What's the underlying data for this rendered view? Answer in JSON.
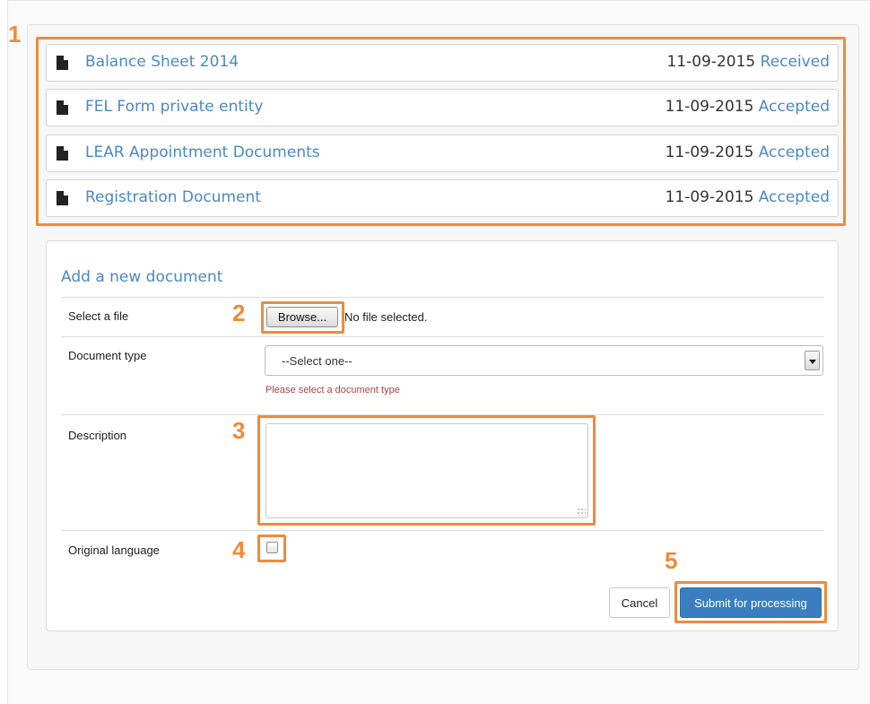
{
  "documents": [
    {
      "title": "Balance Sheet 2014",
      "date": "11-09-2015",
      "status": "Received",
      "icon": "file-icon"
    },
    {
      "title": "FEL Form private entity",
      "date": "11-09-2015",
      "status": "Accepted",
      "icon": "file-icon"
    },
    {
      "title": "LEAR Appointment Documents",
      "date": "11-09-2015",
      "status": "Accepted",
      "icon": "file-icon"
    },
    {
      "title": "Registration Document",
      "date": "11-09-2015",
      "status": "Accepted",
      "icon": "file-icon"
    }
  ],
  "form": {
    "title": "Add a new document",
    "select_file_label": "Select a file",
    "browse_label": "Browse...",
    "file_status": "No file selected.",
    "document_type_label": "Document type",
    "document_type_value": "--Select one--",
    "document_type_error": "Please select a document type",
    "description_label": "Description",
    "description_value": "",
    "original_language_label": "Original language",
    "original_language_checked": false,
    "cancel_label": "Cancel",
    "submit_label": "Submit for processing"
  },
  "callouts": [
    "1",
    "2",
    "3",
    "4",
    "5"
  ],
  "colors": {
    "accent": "#4a89c4",
    "callout": "#f08a3a",
    "primary_button": "#3a7ebf",
    "error": "#a94442"
  }
}
